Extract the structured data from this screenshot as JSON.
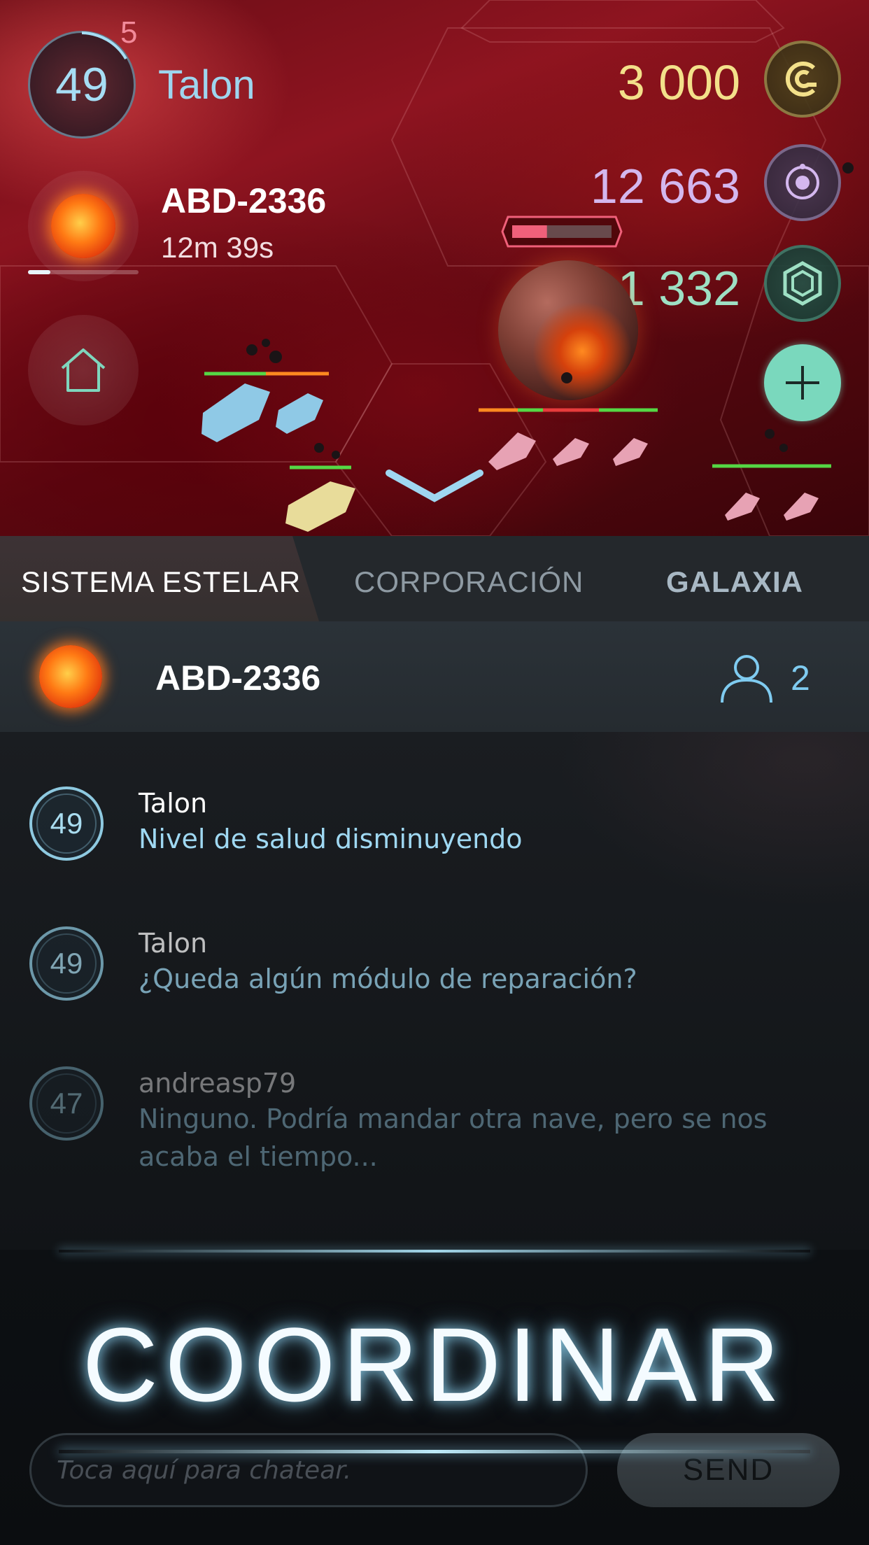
{
  "hud": {
    "level": "49",
    "level_badge": "5",
    "player_name": "Talon",
    "system_name": "ABD-2336",
    "system_timer": "12m 39s",
    "system_progress": 0.2
  },
  "resources": {
    "credits": "3 000",
    "orbs": "12 663",
    "hex": "1 332"
  },
  "target_health": 0.35,
  "colors": {
    "accent_blue": "#9ed5ee",
    "credits": "#f3e08a",
    "orbs": "#d4b7ee",
    "hex": "#9ee0c4",
    "plus_button": "#7ad8bd",
    "health": "#f0607a"
  },
  "icons": [
    "home-icon",
    "credits-icon",
    "orb-icon",
    "hex-icon",
    "plus-icon",
    "chevron-down-icon",
    "user-icon"
  ],
  "tabs": [
    {
      "label": "SISTEMA ESTELAR",
      "active": true
    },
    {
      "label": "CORPORACIÓN",
      "active": false
    },
    {
      "label": "GALAXIA",
      "active": false
    }
  ],
  "channel": {
    "name": "ABD-2336",
    "members": "2"
  },
  "messages": [
    {
      "level": "49",
      "author": "Talon",
      "text": "Nivel de salud disminuyendo"
    },
    {
      "level": "49",
      "author": "Talon",
      "text": "¿Queda algún módulo de reparación?"
    },
    {
      "level": "47",
      "author": "andreasp79",
      "text": "Ninguno. Podría mandar otra nave, pero se nos acaba el tiempo..."
    }
  ],
  "banner": "COORDINAR",
  "chat": {
    "placeholder": "Toca aquí para chatear.",
    "send_label": "SEND"
  }
}
